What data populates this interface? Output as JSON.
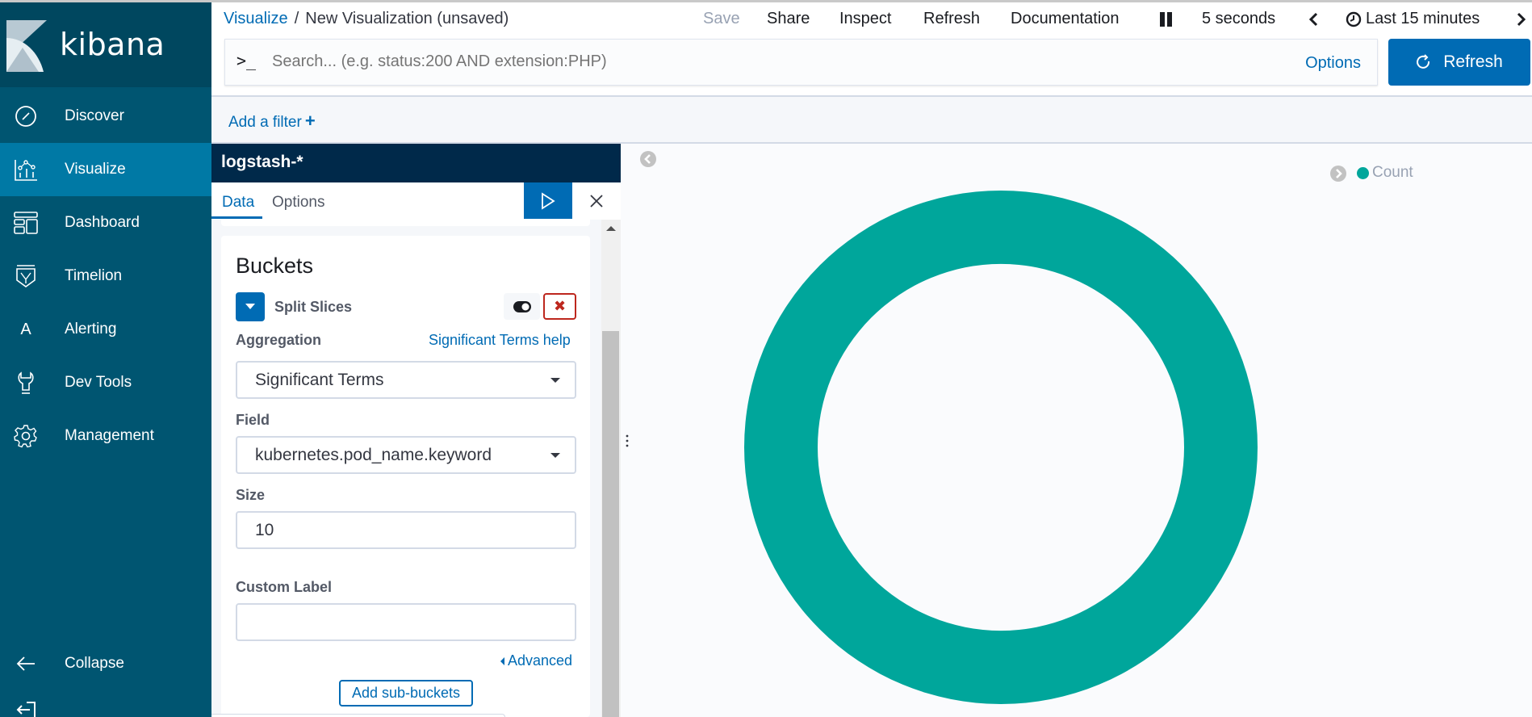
{
  "app": {
    "logo_text": "kibana"
  },
  "sidebar": {
    "items": [
      {
        "label": "Discover",
        "icon": "compass-icon",
        "active": false
      },
      {
        "label": "Visualize",
        "icon": "visualize-icon",
        "active": true
      },
      {
        "label": "Dashboard",
        "icon": "dashboard-icon",
        "active": false
      },
      {
        "label": "Timelion",
        "icon": "timelion-icon",
        "active": false
      },
      {
        "label": "Alerting",
        "icon": "alerting-icon",
        "active": false
      },
      {
        "label": "Dev Tools",
        "icon": "wrench-icon",
        "active": false
      },
      {
        "label": "Management",
        "icon": "gear-icon",
        "active": false
      }
    ],
    "collapse_label": "Collapse",
    "logout_icon": "logout-icon"
  },
  "header": {
    "breadcrumb_root": "Visualize",
    "breadcrumb_sep": "/",
    "breadcrumb_current": "New Visualization (unsaved)",
    "menu": {
      "save": "Save",
      "share": "Share",
      "inspect": "Inspect",
      "refresh": "Refresh",
      "documentation": "Documentation"
    },
    "refresh_interval": "5 seconds",
    "time_range": "Last 15 minutes"
  },
  "search": {
    "prompt": ">_",
    "placeholder": "Search... (e.g. status:200 AND extension:PHP)",
    "value": "",
    "options_label": "Options",
    "refresh_button": "Refresh"
  },
  "filter_bar": {
    "add_filter_label": "Add a filter",
    "plus": "+"
  },
  "editor": {
    "index_pattern": "logstash-*",
    "tabs": [
      {
        "label": "Data",
        "active": true
      },
      {
        "label": "Options",
        "active": false
      }
    ],
    "section_title": "Buckets",
    "bucket_type": "Split Slices",
    "remove_glyph": "✖",
    "aggregation": {
      "label": "Aggregation",
      "help_link": "Significant Terms help",
      "selected": "Significant Terms"
    },
    "field": {
      "label": "Field",
      "selected": "kubernetes.pod_name.keyword"
    },
    "size": {
      "label": "Size",
      "value": "10"
    },
    "custom_label": {
      "label": "Custom Label",
      "value": ""
    },
    "advanced_link": "Advanced",
    "add_sub_buckets": "Add sub-buckets"
  },
  "chart_data": {
    "type": "pie",
    "donut": true,
    "categories": [
      "Count"
    ],
    "values": [
      100
    ],
    "colors": [
      "#00a69b"
    ],
    "legend": [
      {
        "label": "Count",
        "color": "#00a69b"
      }
    ],
    "legend_position": "top-right",
    "title": ""
  },
  "colors": {
    "sidebar_bg": "#005571",
    "sidebar_active": "#0079a5",
    "accent": "#006bb4",
    "danger": "#bd271e",
    "index_header": "#00294a"
  }
}
